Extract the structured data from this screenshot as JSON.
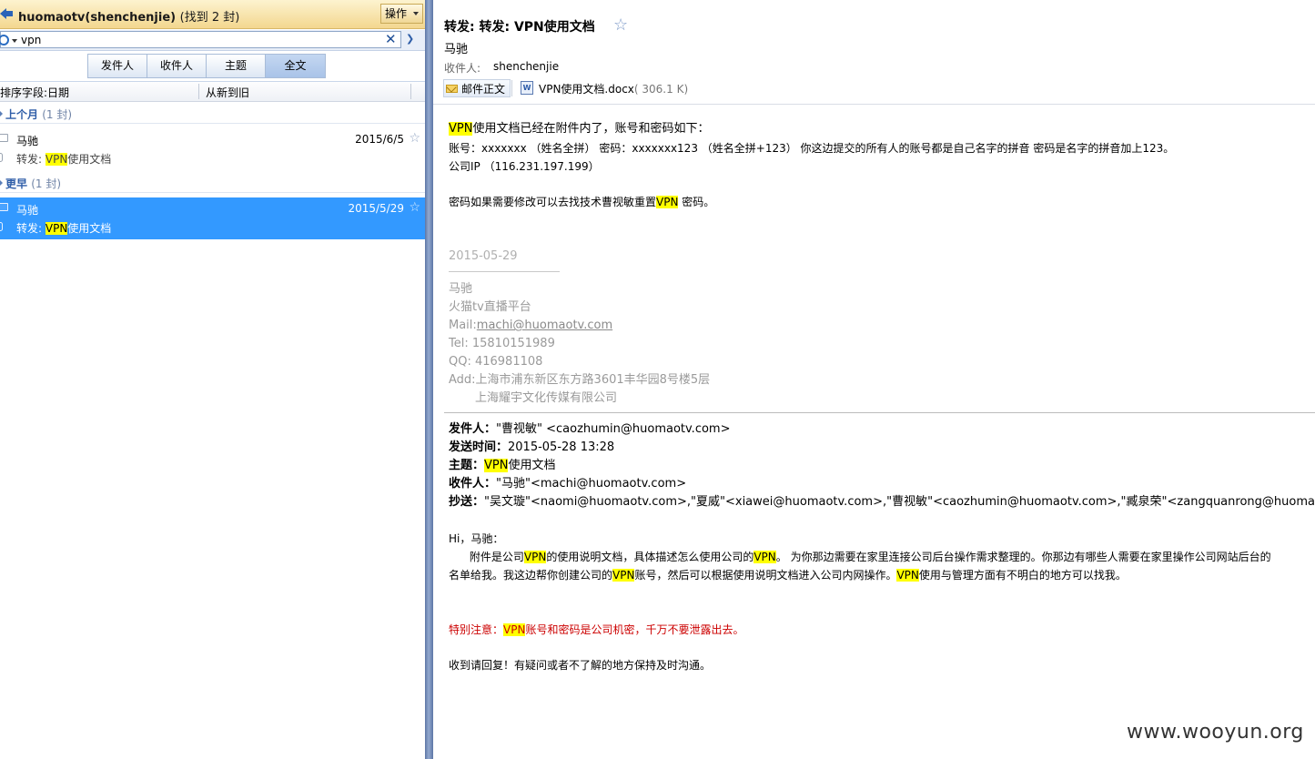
{
  "left_pane": {
    "folder_title": "huomaotv(shenchenjie)",
    "found_count": "(找到 2 封)",
    "ops_button": "操作",
    "search": {
      "value": "vpn",
      "placeholder": ""
    },
    "filter_tabs": [
      "发件人",
      "收件人",
      "主题",
      "全文"
    ],
    "active_filter": "全文",
    "sort_field": "排序字段:日期",
    "sort_order": "从新到旧",
    "groups": [
      {
        "label": "上个月",
        "count": "(1 封)",
        "mail": {
          "sender": "马驰",
          "date": "2015/6/5",
          "subject_prefix": "转发:",
          "subject_hl": "VPN",
          "subject_rest": "使用文档",
          "selected": false
        }
      },
      {
        "label": "更早",
        "count": "(1 封)",
        "mail": {
          "sender": "马驰",
          "date": "2015/5/29",
          "subject_prefix": "转发:",
          "subject_hl": "VPN",
          "subject_rest": "使用文档",
          "selected": true
        }
      }
    ]
  },
  "message": {
    "subject": "转发: 转发: VPN使用文档",
    "from": "马驰",
    "to_label": "收件人:",
    "to": "shenchenjie",
    "body_tab": "邮件正文",
    "attachment_name": "VPN使用文档.docx",
    "attachment_size": "( 306.1 K)",
    "body": {
      "line1_hl": "VPN",
      "line1_rest": "使用文档已经在附件内了，账号和密码如下：",
      "line2": "账号：xxxxxxx （姓名全拼） 密码：xxxxxxx123 （姓名全拼+123） 你这边提交的所有人的账号都是自己名字的拼音 密码是名字的拼音加上123。",
      "line3": "公司IP （116.231.197.199）",
      "line4_pre": "密码如果需要修改可以去找技术曹视敏重置",
      "line4_hl": "VPN",
      "line4_post": " 密码。"
    },
    "signature": {
      "date": "2015-05-29",
      "name": "马驰",
      "company": "火猫tv直播平台",
      "mail_label": "Mail:",
      "mail": "machi@huomaotv.com",
      "tel": "Tel:  15810151989",
      "qq": "QQ: 416981108",
      "add": "Add:上海市浦东新区东方路3601丰华园8号楼5层",
      "add2": "上海耀宇文化传媒有限公司"
    },
    "forwarded": {
      "from_label": "发件人：",
      "from": "\"曹视敏\" <caozhumin@huomaotv.com>",
      "sent_label": "发送时间：",
      "sent": "2015-05-28 13:28",
      "subject_label": "主题：",
      "subject_hl": "VPN",
      "subject_rest": "使用文档",
      "to_label": "收件人：",
      "to": "\"马驰\"<machi@huomaotv.com>",
      "cc_label": "抄送：",
      "cc": "\"吴文璇\"<naomi@huomaotv.com>,\"夏威\"<xiawei@huomaotv.com>,\"曹视敏\"<caozhumin@huomaotv.com>,\"臧泉荣\"<zangquanrong@huomaotv.com>",
      "greeting": "Hi，马驰：",
      "p1_a": "      附件是公司",
      "p1_b": "的使用说明文档，具体描述怎么使用公司的",
      "p1_c": "。 为你那边需要在家里连接公司后台操作需求整理的。你那边有哪些人需要在家里操作公司网站后台的",
      "p2_a": "名单给我。我这边帮你创建公司的",
      "p2_b": "账号，然后可以根据使用说明文档进入公司内网操作。",
      "p2_c": "使用与管理方面有不明白的地方可以找我。",
      "hl": "VPN",
      "warn_a": "特别注意：",
      "warn_b": "账号和密码是公司机密，千万不要泄露出去。",
      "closing": "收到请回复！有疑问或者不了解的地方保持及时沟通。"
    }
  },
  "watermark": "www.wooyun.org",
  "colors": {
    "selection": "#3399ff",
    "highlight": "#ffff00",
    "warning": "#cc0000",
    "folder_bar": "#f3d78f"
  }
}
